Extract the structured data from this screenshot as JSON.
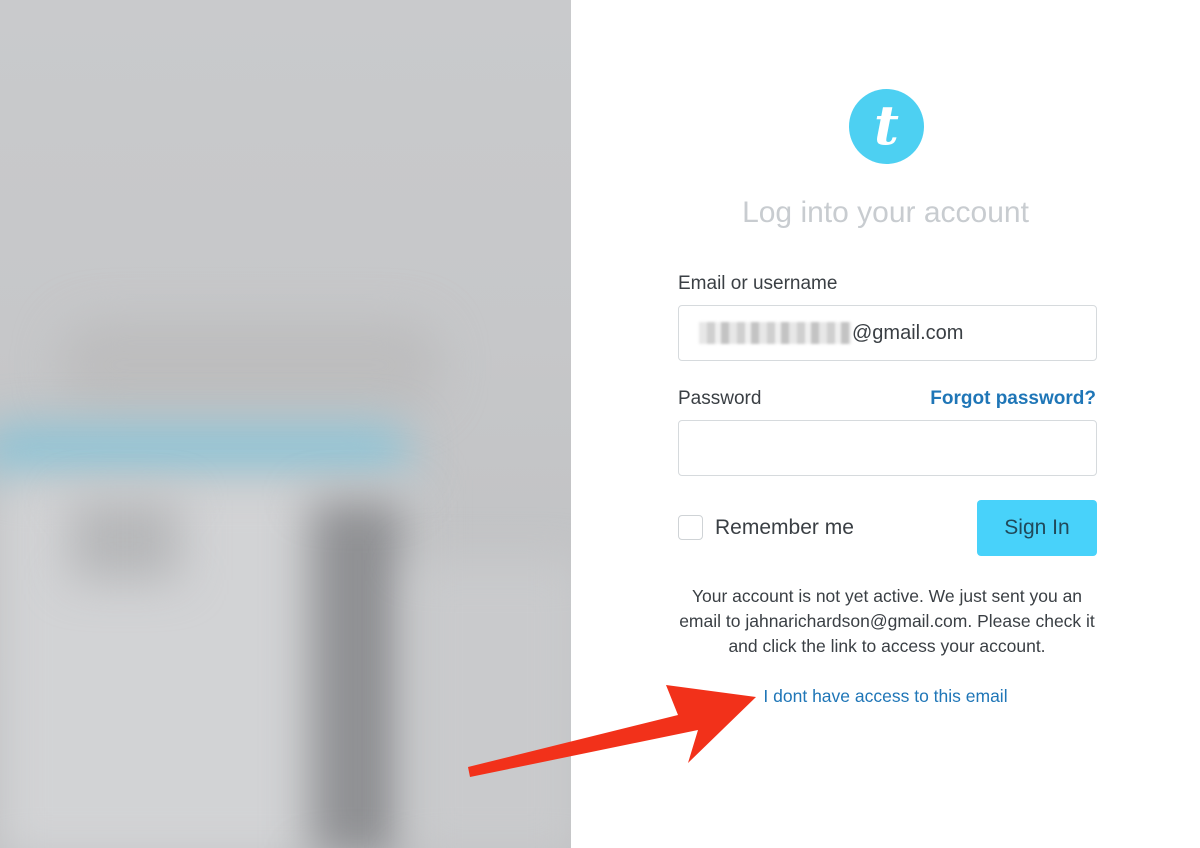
{
  "brand": {
    "logo_letter": "t",
    "logo_color": "#4dd0f2"
  },
  "login": {
    "title": "Log into your account",
    "email_label": "Email or username",
    "email_value_visible": "@gmail.com",
    "password_label": "Password",
    "forgot_password": "Forgot password?",
    "remember_me": "Remember me",
    "sign_in": "Sign In",
    "notice": "Your account is not yet active. We just sent you an email to jahnarichardson@gmail.com. Please check it and click the link to access your account.",
    "no_access_link": "I dont have access to this email"
  },
  "colors": {
    "accent": "#48d2fa",
    "link": "#1f76b7",
    "annotation_arrow": "#f2311a"
  }
}
